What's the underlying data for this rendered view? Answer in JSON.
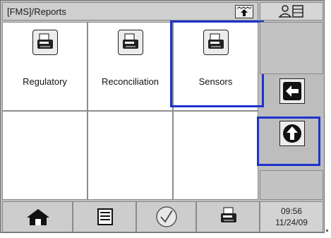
{
  "header": {
    "title": "[FMS]/Reports",
    "title_icon": "up-arrow-folder-icon",
    "user_icon": "user-list-icon"
  },
  "reports": [
    {
      "label": "Regulatory",
      "icon": "printer-icon"
    },
    {
      "label": "Reconciliation",
      "icon": "printer-icon"
    },
    {
      "label": "Sensors",
      "icon": "printer-icon",
      "highlighted": true
    }
  ],
  "side": {
    "back_icon": "left-arrow-icon",
    "up_icon": "up-arrow-circle-icon",
    "up_highlighted": true
  },
  "bottom": {
    "home_icon": "home-icon",
    "list_icon": "list-icon",
    "check_icon": "checkmark-icon",
    "print_icon": "printer-icon",
    "time": "09:56",
    "date": "11/24/09"
  },
  "colors": {
    "highlight": "#1c33cc",
    "panel": "#bdbdbd"
  }
}
